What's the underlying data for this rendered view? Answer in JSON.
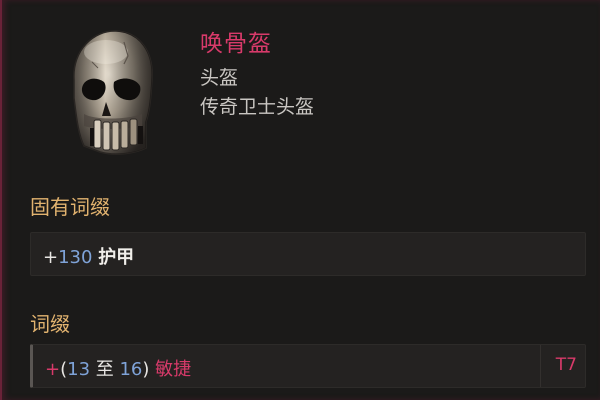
{
  "item": {
    "name": "唤骨盔",
    "type": "头盔",
    "base": "传奇卫士头盔",
    "icon": "skull-helm-icon"
  },
  "implicit": {
    "title": "固有词缀",
    "plus": "+",
    "value": "130",
    "stat": "护甲"
  },
  "affixes": {
    "title": "词缀",
    "items": [
      {
        "plus": "+",
        "open": "(",
        "min": "13",
        "to": " 至 ",
        "max": "16",
        "close": ")",
        "stat": "敏捷",
        "tier": "T7"
      }
    ]
  },
  "colors": {
    "legendary_name": "#d83a6a",
    "section_title": "#e2b36f",
    "number": "#7fa3d8",
    "border_accent": "#6a2238"
  }
}
